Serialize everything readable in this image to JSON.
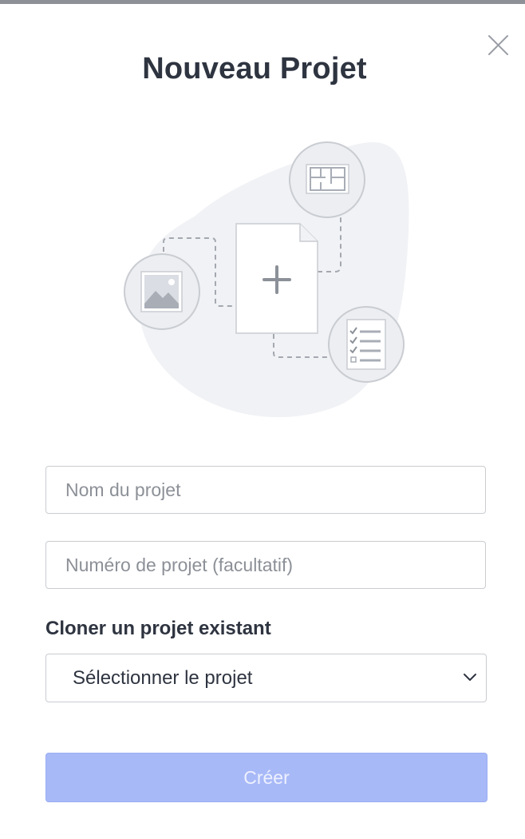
{
  "modal": {
    "title": "Nouveau Projet",
    "close_icon": "close-icon"
  },
  "illustration": {
    "icons": [
      "image-icon",
      "plus-icon",
      "floor-plan-icon",
      "checklist-icon"
    ]
  },
  "form": {
    "name_placeholder": "Nom du projet",
    "name_value": "",
    "number_placeholder": "Numéro de projet (facultatif)",
    "number_value": "",
    "clone_label": "Cloner un projet existant",
    "clone_selected": "Sélectionner le projet",
    "clone_icon": "chevron-down-icon",
    "submit_label": "Créer"
  },
  "colors": {
    "title": "#2e3440",
    "submit_bg": "#a8b9f8",
    "submit_text": "#eef1fe",
    "border": "#c9ccd1",
    "placeholder": "#8c9097",
    "illustration_blob": "#f1f2f5"
  }
}
